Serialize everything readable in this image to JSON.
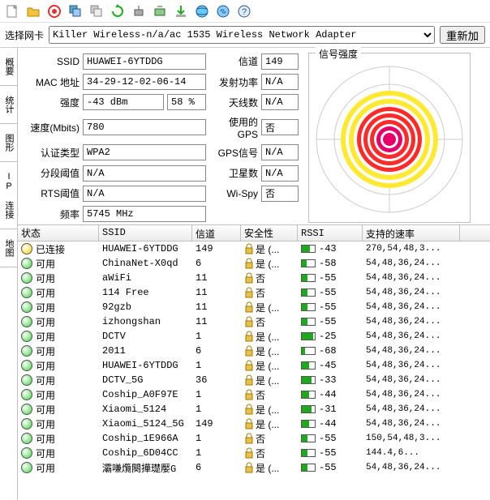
{
  "toolbar_icons": [
    "new",
    "open",
    "target",
    "copy-blue",
    "copy-gray",
    "refresh",
    "ap",
    "rescan",
    "download",
    "globe",
    "link",
    "help"
  ],
  "nic": {
    "label": "选择网卡",
    "value": "Killer Wireless-n/a/ac 1535 Wireless Network Adapter",
    "reload": "重新加"
  },
  "side_tabs": [
    "概要",
    "统计",
    "图形",
    "IP 连接",
    "地图"
  ],
  "form": {
    "ssid_l": "SSID",
    "ssid": "HUAWEI-6YTDDG",
    "mac_l": "MAC 地址",
    "mac": "34-29-12-02-06-14",
    "str_l": "强度",
    "str_a": "-43 dBm",
    "str_b": "58 %",
    "spd_l": "速度(Mbits)",
    "spd": "780",
    "auth_l": "认证类型",
    "auth": "WPA2",
    "seg_l": "分段阈值",
    "seg": "N/A",
    "rts_l": "RTS阈值",
    "rts": "N/A",
    "freq_l": "频率",
    "freq": "5745 MHz",
    "chan_l": "信道",
    "chan": "149",
    "tx_l": "发射功率",
    "tx": "N/A",
    "ant_l": "天线数",
    "ant": "N/A",
    "gpsu_l": "使用的GPS",
    "gpsu": "否",
    "gpss_l": "GPS信号",
    "gpss": "N/A",
    "sat_l": "卫星数",
    "sat": "N/A",
    "wispy_l": "Wi-Spy",
    "wispy": "否"
  },
  "radar_title": "信号强度",
  "cols": {
    "status": "状态",
    "ssid": "SSID",
    "chan": "信道",
    "sec": "安全性",
    "rssi": "RSSI",
    "rate": "支持的速率"
  },
  "sec_yes": "是 (...",
  "sec_no": "否",
  "rows": [
    {
      "st": "已连接",
      "col": "#ffd400",
      "ssid": "HUAWEI-6YTDDG",
      "ch": "149",
      "sec": true,
      "rssi": -43,
      "rate": "270,54,48,3..."
    },
    {
      "st": "可用",
      "col": "#3cd43c",
      "ssid": "ChinaNet-X0qd",
      "ch": "6",
      "sec": true,
      "rssi": -58,
      "rate": "54,48,36,24..."
    },
    {
      "st": "可用",
      "col": "#3cd43c",
      "ssid": "aWiFi",
      "ch": "11",
      "sec": false,
      "rssi": -55,
      "rate": "54,48,36,24..."
    },
    {
      "st": "可用",
      "col": "#3cd43c",
      "ssid": "114 Free",
      "ch": "11",
      "sec": false,
      "rssi": -55,
      "rate": "54,48,36,24..."
    },
    {
      "st": "可用",
      "col": "#3cd43c",
      "ssid": "92gzb",
      "ch": "11",
      "sec": true,
      "rssi": -55,
      "rate": "54,48,36,24..."
    },
    {
      "st": "可用",
      "col": "#3cd43c",
      "ssid": "izhongshan",
      "ch": "11",
      "sec": false,
      "rssi": -55,
      "rate": "54,48,36,24..."
    },
    {
      "st": "可用",
      "col": "#3cd43c",
      "ssid": "DCTV",
      "ch": "1",
      "sec": true,
      "rssi": -25,
      "rate": "54,48,36,24..."
    },
    {
      "st": "可用",
      "col": "#3cd43c",
      "ssid": "2011",
      "ch": "6",
      "sec": true,
      "rssi": -68,
      "rate": "54,48,36,24..."
    },
    {
      "st": "可用",
      "col": "#3cd43c",
      "ssid": "HUAWEI-6YTDDG",
      "ch": "1",
      "sec": true,
      "rssi": -45,
      "rate": "54,48,36,24..."
    },
    {
      "st": "可用",
      "col": "#3cd43c",
      "ssid": "DCTV_5G",
      "ch": "36",
      "sec": true,
      "rssi": -33,
      "rate": "54,48,36,24..."
    },
    {
      "st": "可用",
      "col": "#3cd43c",
      "ssid": "Coship_A0F97E",
      "ch": "1",
      "sec": false,
      "rssi": -44,
      "rate": "54,48,36,24..."
    },
    {
      "st": "可用",
      "col": "#3cd43c",
      "ssid": "Xiaomi_5124",
      "ch": "1",
      "sec": true,
      "rssi": -31,
      "rate": "54,48,36,24..."
    },
    {
      "st": "可用",
      "col": "#3cd43c",
      "ssid": "Xiaomi_5124_5G",
      "ch": "149",
      "sec": true,
      "rssi": -44,
      "rate": "54,48,36,24..."
    },
    {
      "st": "可用",
      "col": "#3cd43c",
      "ssid": "Coship_1E966A",
      "ch": "1",
      "sec": false,
      "rssi": -55,
      "rate": "150,54,48,3..."
    },
    {
      "st": "可用",
      "col": "#3cd43c",
      "ssid": "Coship_6D04CC",
      "ch": "1",
      "sec": false,
      "rssi": -55,
      "rate": "144.4,6..."
    },
    {
      "st": "可用",
      "col": "#3cd43c",
      "ssid": "灞嗛爦闋撶璴嬮G",
      "ch": "6",
      "sec": true,
      "rssi": -55,
      "rate": "54,48,36,24..."
    }
  ]
}
